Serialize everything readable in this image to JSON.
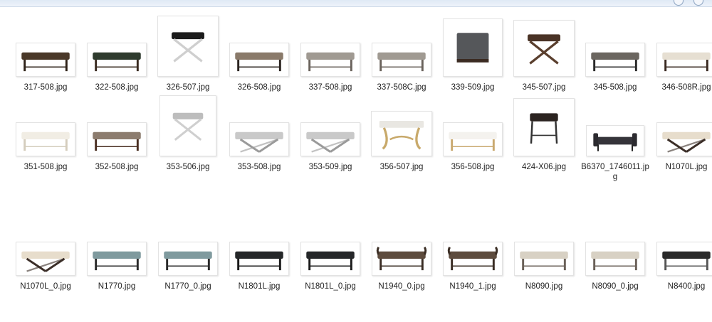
{
  "window": {
    "controls": [
      "minimize-icon",
      "help-icon"
    ]
  },
  "files": [
    {
      "name": "317-508.jpg",
      "kind": "bench-tufted-dark"
    },
    {
      "name": "322-508.jpg",
      "kind": "bench-dark-green"
    },
    {
      "name": "326-507.jpg",
      "kind": "stool-x-chrome-black"
    },
    {
      "name": "326-508.jpg",
      "kind": "bench-light-dark"
    },
    {
      "name": "337-508.jpg",
      "kind": "bench-grey"
    },
    {
      "name": "337-508C.jpg",
      "kind": "bench-grey"
    },
    {
      "name": "339-509.jpg",
      "kind": "cube-ottoman-grey"
    },
    {
      "name": "345-507.jpg",
      "kind": "stool-x-wood"
    },
    {
      "name": "345-508.jpg",
      "kind": "bench-slim-dark"
    },
    {
      "name": "346-508R.jpg",
      "kind": "bench-cream"
    },
    {
      "name": "351-508.jpg",
      "kind": "bench-white"
    },
    {
      "name": "352-508.jpg",
      "kind": "bench-turned"
    },
    {
      "name": "353-506.jpg",
      "kind": "stool-x-silver"
    },
    {
      "name": "353-508.jpg",
      "kind": "bench-x-silver"
    },
    {
      "name": "353-509.jpg",
      "kind": "bench-x-silver"
    },
    {
      "name": "356-507.jpg",
      "kind": "stool-curve-gold"
    },
    {
      "name": "356-508.jpg",
      "kind": "bench-white-gold"
    },
    {
      "name": "424-X06.jpg",
      "kind": "stool-iron"
    },
    {
      "name": "B6370_1746011.jpg",
      "kind": "daybed-dark"
    },
    {
      "name": "N1070L.jpg",
      "kind": "bench-x-cream"
    },
    {
      "name": "N1070L_0.jpg",
      "kind": "bench-x-cream"
    },
    {
      "name": "N1770.jpg",
      "kind": "bench-teal"
    },
    {
      "name": "N1770_0.jpg",
      "kind": "bench-teal"
    },
    {
      "name": "N1801L.jpg",
      "kind": "bench-black-leather"
    },
    {
      "name": "N1801L_0.jpg",
      "kind": "bench-black-leather"
    },
    {
      "name": "N1940_0.jpg",
      "kind": "bench-arms-brown"
    },
    {
      "name": "N1940_1.jpg",
      "kind": "bench-arms-brown"
    },
    {
      "name": "N8090.jpg",
      "kind": "bench-long-light"
    },
    {
      "name": "N8090_0.jpg",
      "kind": "bench-long-light"
    },
    {
      "name": "N8400.jpg",
      "kind": "bench-long-black"
    }
  ],
  "colors": {
    "topbar": "#dfe9f5",
    "label": "#222222",
    "frame_border": "#e3e3e3"
  }
}
